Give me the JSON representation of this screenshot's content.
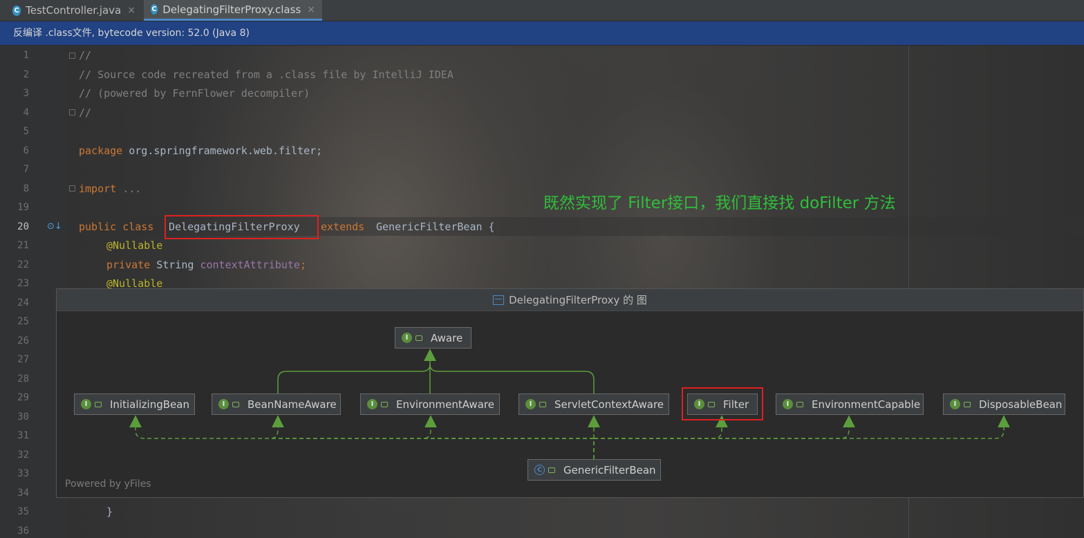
{
  "tabs": [
    {
      "label": "TestController.java",
      "icon": "C",
      "close": "×"
    },
    {
      "label": "DelegatingFilterProxy.class",
      "icon": "C",
      "close": "×"
    }
  ],
  "banner": "反编译 .class文件, bytecode version: 52.0 (Java 8)",
  "editor": {
    "lines": [
      {
        "no": "1",
        "text": "//"
      },
      {
        "no": "2",
        "text": "// Source code recreated from a .class file by IntelliJ IDEA"
      },
      {
        "no": "3",
        "text": "// (powered by FernFlower decompiler)"
      },
      {
        "no": "4",
        "text": "//"
      },
      {
        "no": "5",
        "text": ""
      },
      {
        "no": "6",
        "kw": "package",
        "rest": " org.springframework.web.filter;"
      },
      {
        "no": "7",
        "text": ""
      },
      {
        "no": "8",
        "kw": "import",
        "rest": " ..."
      },
      {
        "no": "19",
        "text": ""
      },
      {
        "no": "20",
        "kw": "public class",
        "name": "DelegatingFilterProxy",
        "kw2": "extends",
        "rest": "GenericFilterBean {"
      },
      {
        "no": "21",
        "annotation": "@Nullable"
      },
      {
        "no": "22",
        "kw": "private",
        "type": " String ",
        "field": "contextAttribute",
        "semi": ";"
      },
      {
        "no": "23",
        "annotation": "@Nullable"
      },
      {
        "no": "24"
      },
      {
        "no": "25"
      },
      {
        "no": "26"
      },
      {
        "no": "27"
      },
      {
        "no": "28"
      },
      {
        "no": "29"
      },
      {
        "no": "30"
      },
      {
        "no": "31"
      },
      {
        "no": "32"
      },
      {
        "no": "33"
      },
      {
        "no": "34"
      },
      {
        "no": "35",
        "text": "}"
      },
      {
        "no": "36"
      }
    ]
  },
  "annotation_note": "既然实现了 Filter接口，我们直接找 doFilter 方法",
  "diagram": {
    "title": "DelegatingFilterProxy 的 图",
    "footer": "Powered by yFiles",
    "interface_badge": "I",
    "class_badge": "C",
    "nodes": {
      "aware": "Aware",
      "initializing_bean": "InitializingBean",
      "bean_name_aware": "BeanNameAware",
      "environment_aware": "EnvironmentAware",
      "servlet_context_aware": "ServletContextAware",
      "filter": "Filter",
      "environment_capable": "EnvironmentCapable",
      "disposable_bean": "DisposableBean",
      "generic_filter_bean": "GenericFilterBean"
    },
    "edge_color": "#5c9e3c"
  }
}
